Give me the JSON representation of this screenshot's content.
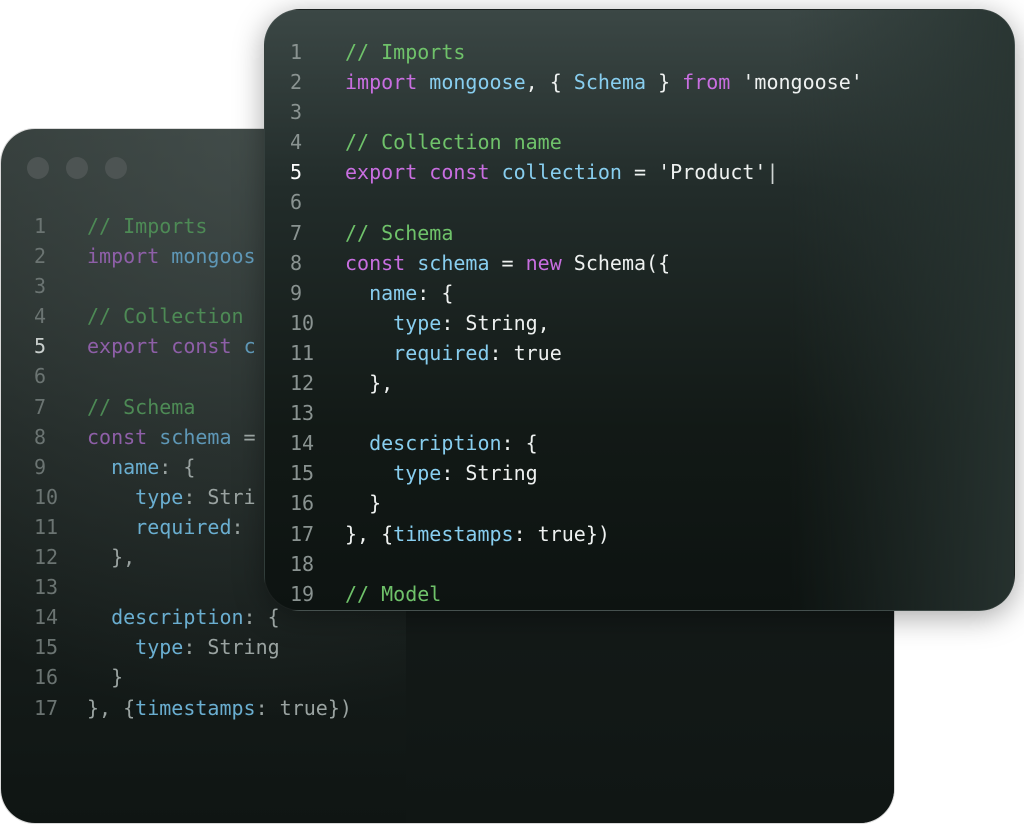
{
  "back_window": {
    "controls": [
      "close-dot",
      "minimize-dot",
      "maximize-dot"
    ],
    "active_line": 5,
    "lines": [
      {
        "n": "1",
        "indent": "",
        "tokens": [
          [
            "cm",
            "// Imports"
          ]
        ]
      },
      {
        "n": "2",
        "indent": "",
        "tokens": [
          [
            "kw",
            "import"
          ],
          [
            "tx",
            " "
          ],
          [
            "id",
            "mongoos"
          ]
        ]
      },
      {
        "n": "3",
        "indent": "",
        "tokens": []
      },
      {
        "n": "4",
        "indent": "",
        "tokens": [
          [
            "cm",
            "// Collection"
          ]
        ]
      },
      {
        "n": "5",
        "indent": "",
        "tokens": [
          [
            "kw",
            "export"
          ],
          [
            "tx",
            " "
          ],
          [
            "kw",
            "const"
          ],
          [
            "tx",
            " "
          ],
          [
            "id",
            "c"
          ]
        ]
      },
      {
        "n": "6",
        "indent": "",
        "tokens": []
      },
      {
        "n": "7",
        "indent": "",
        "tokens": [
          [
            "cm",
            "// Schema"
          ]
        ]
      },
      {
        "n": "8",
        "indent": "",
        "tokens": [
          [
            "kw",
            "const"
          ],
          [
            "tx",
            " "
          ],
          [
            "id",
            "schema"
          ],
          [
            "tx",
            " ="
          ]
        ]
      },
      {
        "n": "9",
        "indent": "  ",
        "tokens": [
          [
            "pr",
            "name"
          ],
          [
            "tx",
            ": {"
          ]
        ]
      },
      {
        "n": "10",
        "indent": "    ",
        "tokens": [
          [
            "pr",
            "type"
          ],
          [
            "tx",
            ": Stri"
          ]
        ]
      },
      {
        "n": "11",
        "indent": "    ",
        "tokens": [
          [
            "pr",
            "required"
          ],
          [
            "tx",
            ":"
          ]
        ]
      },
      {
        "n": "12",
        "indent": "  ",
        "tokens": [
          [
            "tx",
            "},"
          ]
        ]
      },
      {
        "n": "13",
        "indent": "",
        "tokens": []
      },
      {
        "n": "14",
        "indent": "  ",
        "tokens": [
          [
            "pr",
            "description"
          ],
          [
            "tx",
            ": {"
          ]
        ]
      },
      {
        "n": "15",
        "indent": "    ",
        "tokens": [
          [
            "pr",
            "type"
          ],
          [
            "tx",
            ": String"
          ]
        ]
      },
      {
        "n": "16",
        "indent": "  ",
        "tokens": [
          [
            "tx",
            "}"
          ]
        ]
      },
      {
        "n": "17",
        "indent": "",
        "tokens": [
          [
            "tx",
            "}, {"
          ],
          [
            "pr",
            "timestamps"
          ],
          [
            "tx",
            ": true})"
          ]
        ]
      }
    ]
  },
  "front_window": {
    "active_line": 5,
    "lines": [
      {
        "n": "1",
        "indent": "",
        "tokens": [
          [
            "cm",
            "// Imports"
          ]
        ]
      },
      {
        "n": "2",
        "indent": "",
        "tokens": [
          [
            "kw",
            "import"
          ],
          [
            "tx",
            " "
          ],
          [
            "id",
            "mongoose"
          ],
          [
            "tx",
            ", { "
          ],
          [
            "id",
            "Schema"
          ],
          [
            "tx",
            " } "
          ],
          [
            "kw",
            "from"
          ],
          [
            "tx",
            " 'mongoose'"
          ]
        ]
      },
      {
        "n": "3",
        "indent": "",
        "tokens": []
      },
      {
        "n": "4",
        "indent": "",
        "tokens": [
          [
            "cm",
            "// Collection name"
          ]
        ]
      },
      {
        "n": "5",
        "indent": "",
        "tokens": [
          [
            "kw",
            "export"
          ],
          [
            "tx",
            " "
          ],
          [
            "kw",
            "const"
          ],
          [
            "tx",
            " "
          ],
          [
            "id",
            "collection"
          ],
          [
            "tx",
            " = 'Product'"
          ],
          [
            "cursor",
            "|"
          ]
        ]
      },
      {
        "n": "6",
        "indent": "",
        "tokens": []
      },
      {
        "n": "7",
        "indent": "",
        "tokens": [
          [
            "cm",
            "// Schema"
          ]
        ]
      },
      {
        "n": "8",
        "indent": "",
        "tokens": [
          [
            "kw",
            "const"
          ],
          [
            "tx",
            " "
          ],
          [
            "id",
            "schema"
          ],
          [
            "tx",
            " = "
          ],
          [
            "kw",
            "new"
          ],
          [
            "tx",
            " Schema({"
          ]
        ]
      },
      {
        "n": "9",
        "indent": "  ",
        "tokens": [
          [
            "pr",
            "name"
          ],
          [
            "tx",
            ": {"
          ]
        ]
      },
      {
        "n": "10",
        "indent": "    ",
        "tokens": [
          [
            "pr",
            "type"
          ],
          [
            "tx",
            ": String,"
          ]
        ]
      },
      {
        "n": "11",
        "indent": "    ",
        "tokens": [
          [
            "pr",
            "required"
          ],
          [
            "tx",
            ": true"
          ]
        ]
      },
      {
        "n": "12",
        "indent": "  ",
        "tokens": [
          [
            "tx",
            "},"
          ]
        ]
      },
      {
        "n": "13",
        "indent": "",
        "tokens": []
      },
      {
        "n": "14",
        "indent": "  ",
        "tokens": [
          [
            "pr",
            "description"
          ],
          [
            "tx",
            ": {"
          ]
        ]
      },
      {
        "n": "15",
        "indent": "    ",
        "tokens": [
          [
            "pr",
            "type"
          ],
          [
            "tx",
            ": String"
          ]
        ]
      },
      {
        "n": "16",
        "indent": "  ",
        "tokens": [
          [
            "tx",
            "}"
          ]
        ]
      },
      {
        "n": "17",
        "indent": "",
        "tokens": [
          [
            "tx",
            "}, {"
          ],
          [
            "pr",
            "timestamps"
          ],
          [
            "tx",
            ": true})"
          ]
        ]
      },
      {
        "n": "18",
        "indent": "",
        "tokens": []
      },
      {
        "n": "19",
        "indent": "",
        "tokens": [
          [
            "cm",
            "// Model"
          ]
        ]
      }
    ]
  }
}
